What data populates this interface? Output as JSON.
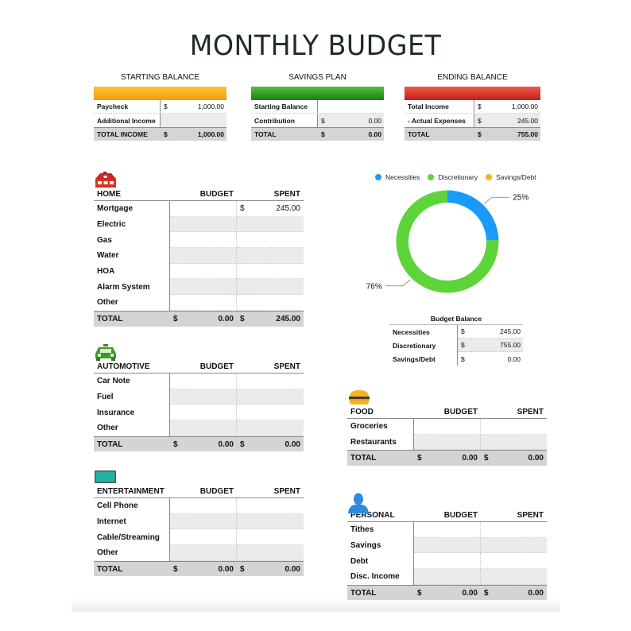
{
  "title": "MONTHLY BUDGET",
  "colors": {
    "starting_bar": "#f7a81b",
    "savings_bar": "#2e9a22",
    "ending_bar": "#d9372b",
    "necessities": "#1a9bfb",
    "discretionary": "#5dd43a",
    "savings_debt": "#f6b21d"
  },
  "starting_balance": {
    "caption": "STARTING BALANCE",
    "rows": [
      {
        "label": "Paycheck",
        "currency": "$",
        "value": "1,000.00"
      },
      {
        "label": "Additional Income",
        "currency": "",
        "value": ""
      }
    ],
    "total": {
      "label": "TOTAL INCOME",
      "currency": "$",
      "value": "1,000.00"
    }
  },
  "savings_plan": {
    "caption": "SAVINGS PLAN",
    "rows": [
      {
        "label": "Starting Balance",
        "currency": "",
        "value": ""
      },
      {
        "label": "Contribution",
        "currency": "$",
        "value": "0.00"
      }
    ],
    "total": {
      "label": "TOTAL",
      "currency": "$",
      "value": "0.00"
    }
  },
  "ending_balance": {
    "caption": "ENDING BALANCE",
    "rows": [
      {
        "label": "Total Income",
        "currency": "$",
        "value": "1,000.00"
      },
      {
        "label": "- Actual Expenses",
        "currency": "$",
        "value": "245.00"
      }
    ],
    "total": {
      "label": "TOTAL",
      "currency": "$",
      "value": "755.00"
    }
  },
  "categories": {
    "home": {
      "icon": "house-icon",
      "header": {
        "name": "HOME",
        "budget": "BUDGET",
        "spent": "SPENT"
      },
      "rows": [
        {
          "label": "Mortgage",
          "budget": "",
          "spent_cur": "$",
          "spent": "245.00"
        },
        {
          "label": "Electric",
          "budget": "",
          "spent_cur": "",
          "spent": ""
        },
        {
          "label": "Gas",
          "budget": "",
          "spent_cur": "",
          "spent": ""
        },
        {
          "label": "Water",
          "budget": "",
          "spent_cur": "",
          "spent": ""
        },
        {
          "label": "HOA",
          "budget": "",
          "spent_cur": "",
          "spent": ""
        },
        {
          "label": "Alarm System",
          "budget": "",
          "spent_cur": "",
          "spent": ""
        },
        {
          "label": "Other",
          "budget": "",
          "spent_cur": "",
          "spent": ""
        }
      ],
      "total": {
        "label": "TOTAL",
        "budget_cur": "$",
        "budget": "0.00",
        "spent_cur": "$",
        "spent": "245.00"
      }
    },
    "automotive": {
      "icon": "car-icon",
      "header": {
        "name": "AUTOMOTIVE",
        "budget": "BUDGET",
        "spent": "SPENT"
      },
      "rows": [
        {
          "label": "Car Note"
        },
        {
          "label": "Fuel"
        },
        {
          "label": "Insurance"
        },
        {
          "label": "Other"
        }
      ],
      "total": {
        "label": "TOTAL",
        "budget_cur": "$",
        "budget": "0.00",
        "spent_cur": "$",
        "spent": "0.00"
      }
    },
    "entertainment": {
      "icon": "tv-icon",
      "header": {
        "name": "ENTERTAINMENT",
        "budget": "BUDGET",
        "spent": "SPENT"
      },
      "rows": [
        {
          "label": "Cell Phone"
        },
        {
          "label": "Internet"
        },
        {
          "label": "Cable/Streaming"
        },
        {
          "label": "Other"
        }
      ],
      "total": {
        "label": "TOTAL",
        "budget_cur": "$",
        "budget": "0.00",
        "spent_cur": "$",
        "spent": "0.00"
      }
    },
    "food": {
      "icon": "burger-icon",
      "header": {
        "name": "FOOD",
        "budget": "BUDGET",
        "spent": "SPENT"
      },
      "rows": [
        {
          "label": "Groceries"
        },
        {
          "label": "Restaurants"
        }
      ],
      "total": {
        "label": "TOTAL",
        "budget_cur": "$",
        "budget": "0.00",
        "spent_cur": "$",
        "spent": "0.00"
      }
    },
    "personal": {
      "icon": "person-icon",
      "header": {
        "name": "PERSONAL",
        "budget": "BUDGET",
        "spent": "SPENT"
      },
      "rows": [
        {
          "label": "Tithes"
        },
        {
          "label": "Savings"
        },
        {
          "label": "Debt"
        },
        {
          "label": "Disc. Income"
        }
      ],
      "total": {
        "label": "TOTAL",
        "budget_cur": "$",
        "budget": "0.00",
        "spent_cur": "$",
        "spent": "0.00"
      }
    }
  },
  "chart_data": {
    "type": "pie",
    "variant": "donut",
    "title": "",
    "legend": [
      "Necessities",
      "Discretionary",
      "Savings/Debt"
    ],
    "legend_position": "top",
    "categories": [
      "Necessities",
      "Discretionary",
      "Savings/Debt"
    ],
    "values": [
      245.0,
      755.0,
      0.0
    ],
    "labels": [
      "25%",
      "76%",
      ""
    ]
  },
  "budget_balance": {
    "caption": "Budget Balance",
    "rows": [
      {
        "label": "Necessities",
        "currency": "$",
        "value": "245.00"
      },
      {
        "label": "Discretionary",
        "currency": "$",
        "value": "755.00"
      },
      {
        "label": "Savings/Debt",
        "currency": "$",
        "value": "0.00"
      }
    ]
  }
}
